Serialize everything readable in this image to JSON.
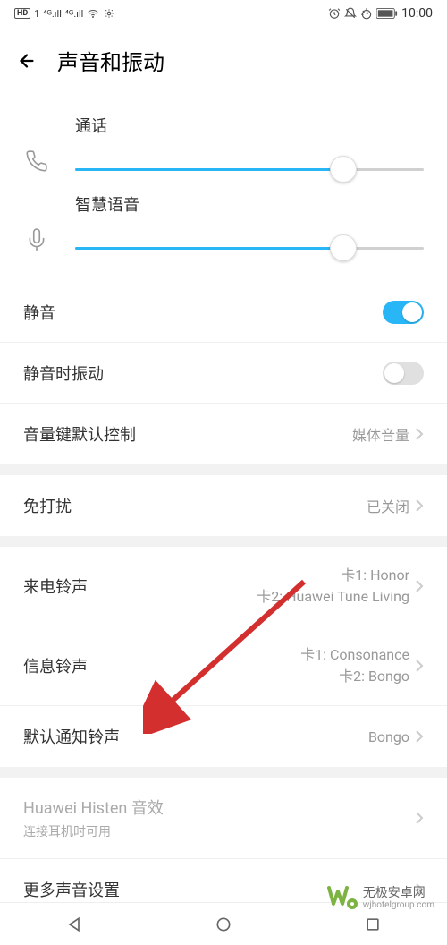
{
  "status_bar": {
    "hd": "HD",
    "sim1": "1",
    "net": "4G",
    "time": "10:00"
  },
  "header": {
    "title": "声音和振动"
  },
  "sliders": {
    "call": {
      "label": "通话",
      "percent": 77
    },
    "voice": {
      "label": "智慧语音",
      "percent": 77
    }
  },
  "settings": {
    "mute": {
      "label": "静音",
      "on": true
    },
    "vibrate_on_mute": {
      "label": "静音时振动",
      "on": false
    },
    "volume_key": {
      "label": "音量键默认控制",
      "value": "媒体音量"
    },
    "dnd": {
      "label": "免打扰",
      "value": "已关闭"
    },
    "call_ring": {
      "label": "来电铃声",
      "line1": "卡1: Honor",
      "line2": "卡2: Huawei Tune Living"
    },
    "msg_ring": {
      "label": "信息铃声",
      "line1": "卡1: Consonance",
      "line2": "卡2: Bongo"
    },
    "notif_ring": {
      "label": "默认通知铃声",
      "value": "Bongo"
    },
    "histen": {
      "label": "Huawei Histen 音效",
      "sub": "连接耳机时可用"
    },
    "more": {
      "label": "更多声音设置"
    }
  },
  "watermark": {
    "main": "无极安卓网",
    "sub": "wjhotelgroup.com"
  }
}
